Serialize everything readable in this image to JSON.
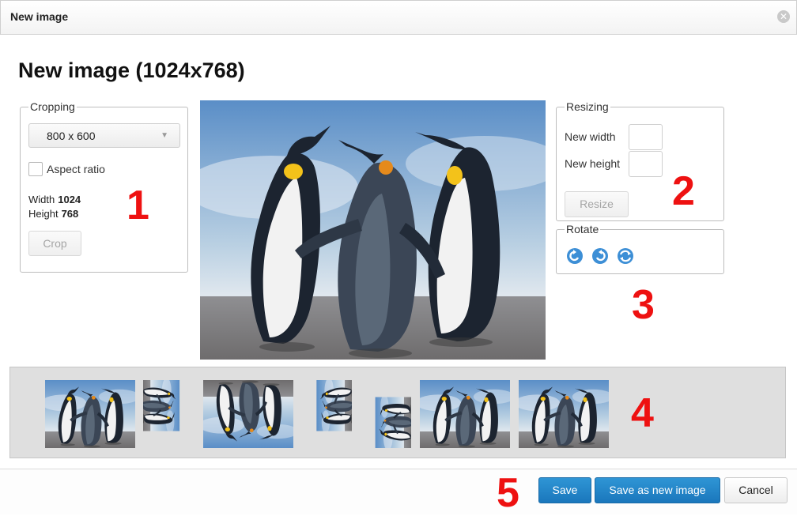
{
  "dialog": {
    "title": "New image",
    "heading": "New image (1024x768)"
  },
  "cropping": {
    "legend": "Cropping",
    "preset": "800 x 600",
    "aspect_label": "Aspect ratio",
    "aspect_checked": false,
    "width_label": "Width",
    "width_value": "1024",
    "height_label": "Height",
    "height_value": "768",
    "crop_label": "Crop"
  },
  "resizing": {
    "legend": "Resizing",
    "width_label": "New width",
    "width_value": "",
    "height_label": "New height",
    "height_value": "",
    "resize_label": "Resize"
  },
  "rotate": {
    "legend": "Rotate",
    "icons": [
      "rotate-left-icon",
      "rotate-right-icon",
      "flip-icon"
    ]
  },
  "thumbnails": {
    "count": 7,
    "variants": [
      "original",
      "rotated-90",
      "flipped-vertical",
      "rotated-90-mirrored",
      "rotated-270",
      "original",
      "original"
    ]
  },
  "annotations": [
    "1",
    "2",
    "3",
    "4",
    "5"
  ],
  "footer": {
    "save_label": "Save",
    "save_new_label": "Save as new image",
    "cancel_label": "Cancel"
  },
  "colors": {
    "primary_button": "#1a77bc",
    "annotation": "#ee1111"
  }
}
